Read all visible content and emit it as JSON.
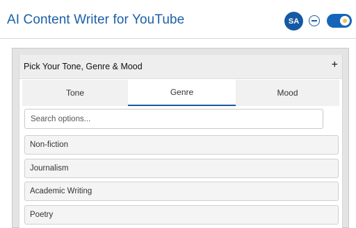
{
  "header": {
    "title": "AI Content Writer for YouTube",
    "avatar_initials": "SA",
    "minimize_icon": "minus-circle-icon",
    "toggle_state": "on"
  },
  "panel": {
    "title": "Pick Your Tone, Genre & Mood",
    "expand_symbol": "+",
    "tabs": [
      {
        "label": "Tone"
      },
      {
        "label": "Genre"
      },
      {
        "label": "Mood"
      }
    ],
    "active_tab": "Genre",
    "search_placeholder": "Search options...",
    "options": [
      {
        "label": "Non-fiction"
      },
      {
        "label": "Journalism"
      },
      {
        "label": "Academic Writing"
      },
      {
        "label": "Poetry"
      }
    ]
  },
  "colors": {
    "accent": "#1659a3",
    "title": "#1b5fa8",
    "toggle": "#1566b8"
  }
}
